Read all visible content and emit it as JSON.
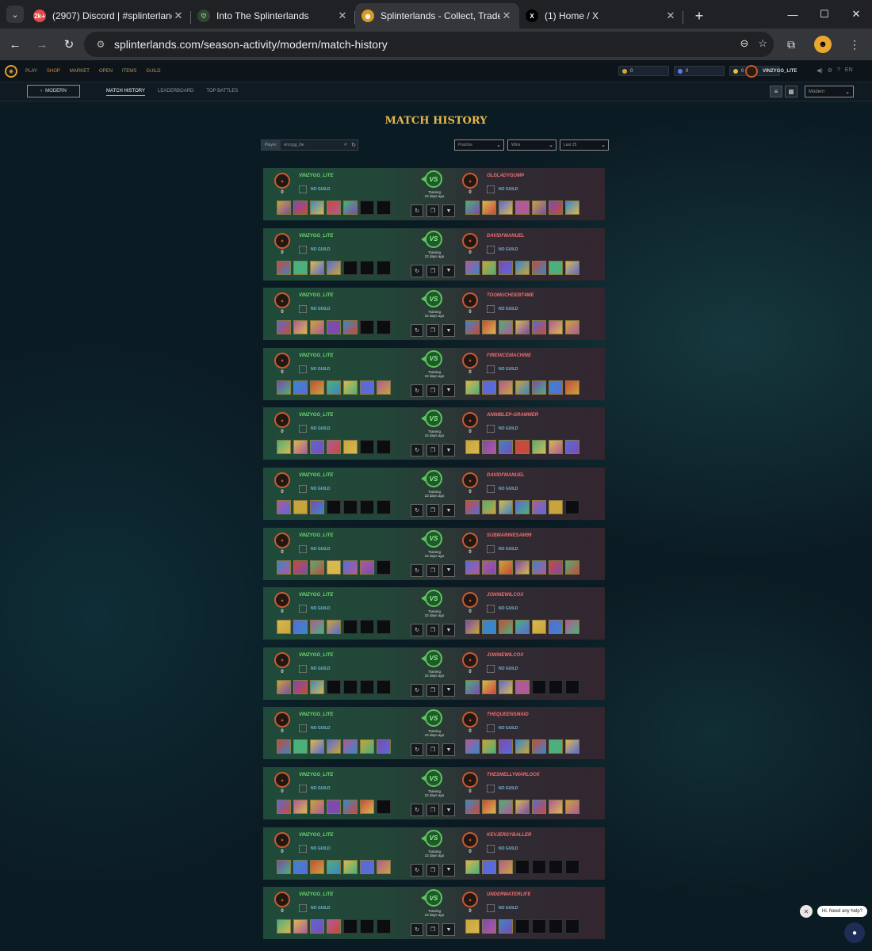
{
  "browser": {
    "tabs": [
      {
        "title": "(2907) Discord | #splinterlands-",
        "fav_text": "2k+",
        "fav_color": "#e24a4a",
        "active": false
      },
      {
        "title": "Into The Splinterlands",
        "fav_text": "♡",
        "fav_color": "#2b4a2b",
        "active": false
      },
      {
        "title": "Splinterlands - Collect, Trade, Ba",
        "fav_text": "◉",
        "fav_color": "#d89a20",
        "active": true
      },
      {
        "title": "(1) Home / X",
        "fav_text": "X",
        "fav_color": "#000000",
        "active": false
      }
    ],
    "url": "splinterlands.com/season-activity/modern/match-history"
  },
  "site": {
    "menu": [
      "PLAY",
      "SHOP",
      "MARKET",
      "OPEN",
      "ITEMS",
      "GUILD"
    ],
    "wallet": [
      {
        "value": "0",
        "color": "#e0a030"
      },
      {
        "value": "0",
        "color": "#5a7af0"
      },
      {
        "value": "0",
        "color": "#e0c040"
      }
    ],
    "username": "VINZYGG_LITE",
    "lang": "EN",
    "back_label": "MODERN",
    "subtabs": [
      "MATCH HISTORY",
      "LEADERBOARD",
      "TOP BATTLES"
    ],
    "format_select": "Modern",
    "page_title": "MATCH HISTORY",
    "filter": {
      "label": "Player:",
      "value": "vinzygg_lite"
    },
    "selects": [
      "Practice",
      "Wins",
      "Last 25"
    ]
  },
  "matches": [
    {
      "me": "VINZYGG_LITE",
      "my_score": "0",
      "my_guild": "NO GUILD",
      "opp": "OLDLADYGUMP",
      "opp_score": "0",
      "opp_guild": "NO GUILD",
      "type": "Training",
      "when": "22 days ago",
      "my_cards": 5,
      "opp_cards": 7
    },
    {
      "me": "VINZYGG_LITE",
      "my_score": "0",
      "my_guild": "NO GUILD",
      "opp": "DAVIDFMANUEL",
      "opp_score": "0",
      "opp_guild": "NO GUILD",
      "type": "Training",
      "when": "22 days ago",
      "my_cards": 4,
      "opp_cards": 7
    },
    {
      "me": "VINZYGG_LITE",
      "my_score": "0",
      "my_guild": "NO GUILD",
      "opp": "TOOMUCHDEBT4ME",
      "opp_score": "0",
      "opp_guild": "NO GUILD",
      "type": "Training",
      "when": "22 days ago",
      "my_cards": 5,
      "opp_cards": 7
    },
    {
      "me": "VINZYGG_LITE",
      "my_score": "0",
      "my_guild": "NO GUILD",
      "opp": "FIRENICEMACHINE",
      "opp_score": "0",
      "opp_guild": "NO GUILD",
      "type": "Training",
      "when": "22 days ago",
      "my_cards": 7,
      "opp_cards": 7
    },
    {
      "me": "VINZYGG_LITE",
      "my_score": "0",
      "my_guild": "NO GUILD",
      "opp": "ANIMBLEP-GRAMMER",
      "opp_score": "0",
      "opp_guild": "NO GUILD",
      "type": "Training",
      "when": "22 days ago",
      "my_cards": 5,
      "opp_cards": 7
    },
    {
      "me": "VINZYGG_LITE",
      "my_score": "0",
      "my_guild": "NO GUILD",
      "opp": "DAVIDFMANUEL",
      "opp_score": "0",
      "opp_guild": "NO GUILD",
      "type": "Training",
      "when": "22 days ago",
      "my_cards": 3,
      "opp_cards": 6
    },
    {
      "me": "VINZYGG_LITE",
      "my_score": "0",
      "my_guild": "NO GUILD",
      "opp": "SUBMARINESAM99",
      "opp_score": "0",
      "opp_guild": "NO GUILD",
      "type": "Training",
      "when": "22 days ago",
      "my_cards": 6,
      "opp_cards": 7
    },
    {
      "me": "VINZYGG_LITE",
      "my_score": "0",
      "my_guild": "NO GUILD",
      "opp": "JONNIEWILCOX",
      "opp_score": "0",
      "opp_guild": "NO GUILD",
      "type": "Training",
      "when": "22 days ago",
      "my_cards": 4,
      "opp_cards": 7
    },
    {
      "me": "VINZYGG_LITE",
      "my_score": "0",
      "my_guild": "NO GUILD",
      "opp": "JONNIEWILCOX",
      "opp_score": "0",
      "opp_guild": "NO GUILD",
      "type": "Training",
      "when": "22 days ago",
      "my_cards": 3,
      "opp_cards": 4
    },
    {
      "me": "VINZYGG_LITE",
      "my_score": "0",
      "my_guild": "NO GUILD",
      "opp": "THEQUEENSMAID",
      "opp_score": "0",
      "opp_guild": "NO GUILD",
      "type": "Training",
      "when": "22 days ago",
      "my_cards": 7,
      "opp_cards": 7
    },
    {
      "me": "VINZYGG_LITE",
      "my_score": "0",
      "my_guild": "NO GUILD",
      "opp": "THESMELLYWARLOCK",
      "opp_score": "0",
      "opp_guild": "NO GUILD",
      "type": "Training",
      "when": "22 days ago",
      "my_cards": 6,
      "opp_cards": 7
    },
    {
      "me": "VINZYGG_LITE",
      "my_score": "0",
      "my_guild": "NO GUILD",
      "opp": "KEVJERSYBALLER",
      "opp_score": "0",
      "opp_guild": "NO GUILD",
      "type": "Training",
      "when": "22 days ago",
      "my_cards": 7,
      "opp_cards": 3
    },
    {
      "me": "VINZYGG_LITE",
      "my_score": "0",
      "my_guild": "NO GUILD",
      "opp": "UNDERWATERLIFE",
      "opp_score": "0",
      "opp_guild": "NO GUILD",
      "type": "Training",
      "when": "22 days ago",
      "my_cards": 4,
      "opp_cards": 3
    }
  ],
  "help": {
    "message": "Hi. Need any help?"
  }
}
